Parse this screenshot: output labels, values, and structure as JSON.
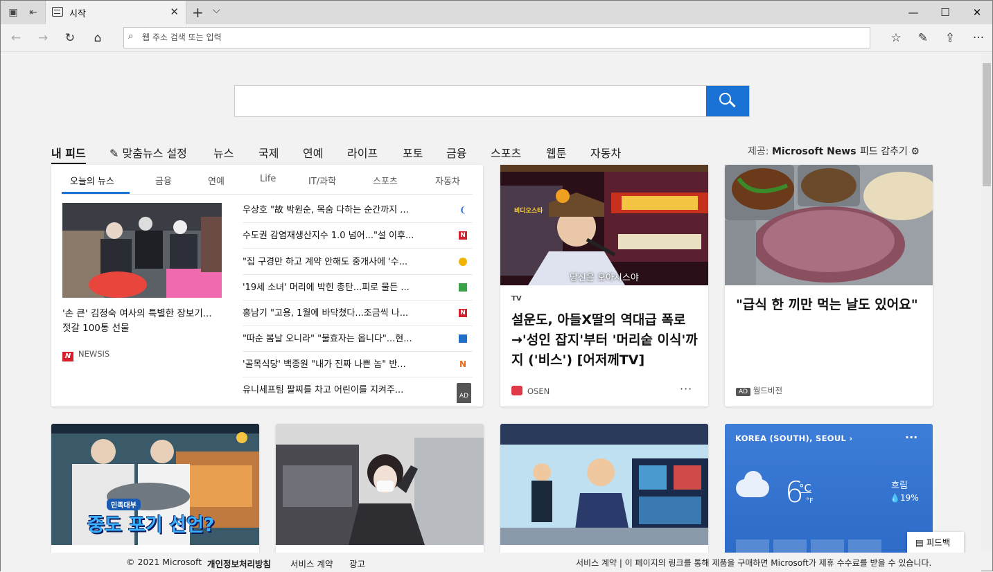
{
  "tab": {
    "title": "시작"
  },
  "address": {
    "placeholder": "웹 주소 검색 또는 입력"
  },
  "feed_menu": {
    "my_feed": "내 피드",
    "personalize": "맞춤뉴스 설정",
    "items": [
      "뉴스",
      "국제",
      "연예",
      "라이프",
      "포토",
      "금융",
      "스포츠",
      "웹툰",
      "자동차"
    ],
    "provider_label": "제공:",
    "provider": "Microsoft News",
    "hide_feed": "피드 감추기"
  },
  "news_tabs": [
    "오늘의 뉴스",
    "금융",
    "연예",
    "Life",
    "IT/과학",
    "스포츠",
    "자동차"
  ],
  "lead": {
    "title": "'손 큰' 김정숙 여사의 특별한 장보기...젓갈 100통 선물",
    "source": "NEWSIS"
  },
  "headlines": [
    {
      "text": "우상호 \"故 박원순, 목숨 다하는 순간까지 ...",
      "icon": "blue-leaf-icon"
    },
    {
      "text": "수도권 감염재생산지수 1.0 넘어...\"설 이후...",
      "icon": "newsis-icon"
    },
    {
      "text": "\"집 구경만 하고 계약 안해도 중개사에 '수...",
      "icon": "yellow-circle-icon"
    },
    {
      "text": "'19세 소녀' 머리에 박힌 총탄...피로 물든 ...",
      "icon": "green-square-icon"
    },
    {
      "text": "홍남기 \"고용, 1월에 바닥쳤다...조금씩 나...",
      "icon": "newsis-icon"
    },
    {
      "text": "\"따순 봄날 오니라\" \"불효자는 옵니다\"...현...",
      "icon": "blue-square-icon"
    },
    {
      "text": "'골목식당' 백종원 \"내가 진짜 나쁜 놈\" 반...",
      "icon": "orange-n-icon"
    },
    {
      "text": "유니세프팀 팔찌를 차고 어린이를 지켜주...",
      "icon": "ad-badge",
      "ad": "AD"
    }
  ],
  "card_tv": {
    "category": "TV",
    "title": "설운도, 아들X딸의 역대급 폭로→'성인 잡지'부터 '머리숱 이식'까지 ('비스') [어저께TV]",
    "source": "OSEN",
    "overlay_top": "비디오스타",
    "overlay_bottom": "당신은 오아시스야",
    "more": "···"
  },
  "card_food": {
    "title": "\"급식 한 끼만 먹는 날도 있어요\"",
    "ad": "AD",
    "source": "월드비전"
  },
  "card_row2": {
    "show_caption": "중도 포기 선언?",
    "show_caption_top": "민족대부"
  },
  "weather": {
    "location": "KOREA (SOUTH), SEOUL",
    "temp": "6",
    "unit_c": "°C",
    "unit_f": "°F",
    "condition": "흐림",
    "precip": "19%",
    "more": "···"
  },
  "feedback": "피드백",
  "footer": {
    "copyright": "© 2021 Microsoft",
    "privacy": "개인정보처리방침",
    "terms": "서비스 계약",
    "ads": "광고",
    "right": "서비스 계약 | 이 페이지의 링크를 통해 제품을 구매하면 Microsoft가 제휴 수수료를 받을 수 있습니다."
  }
}
